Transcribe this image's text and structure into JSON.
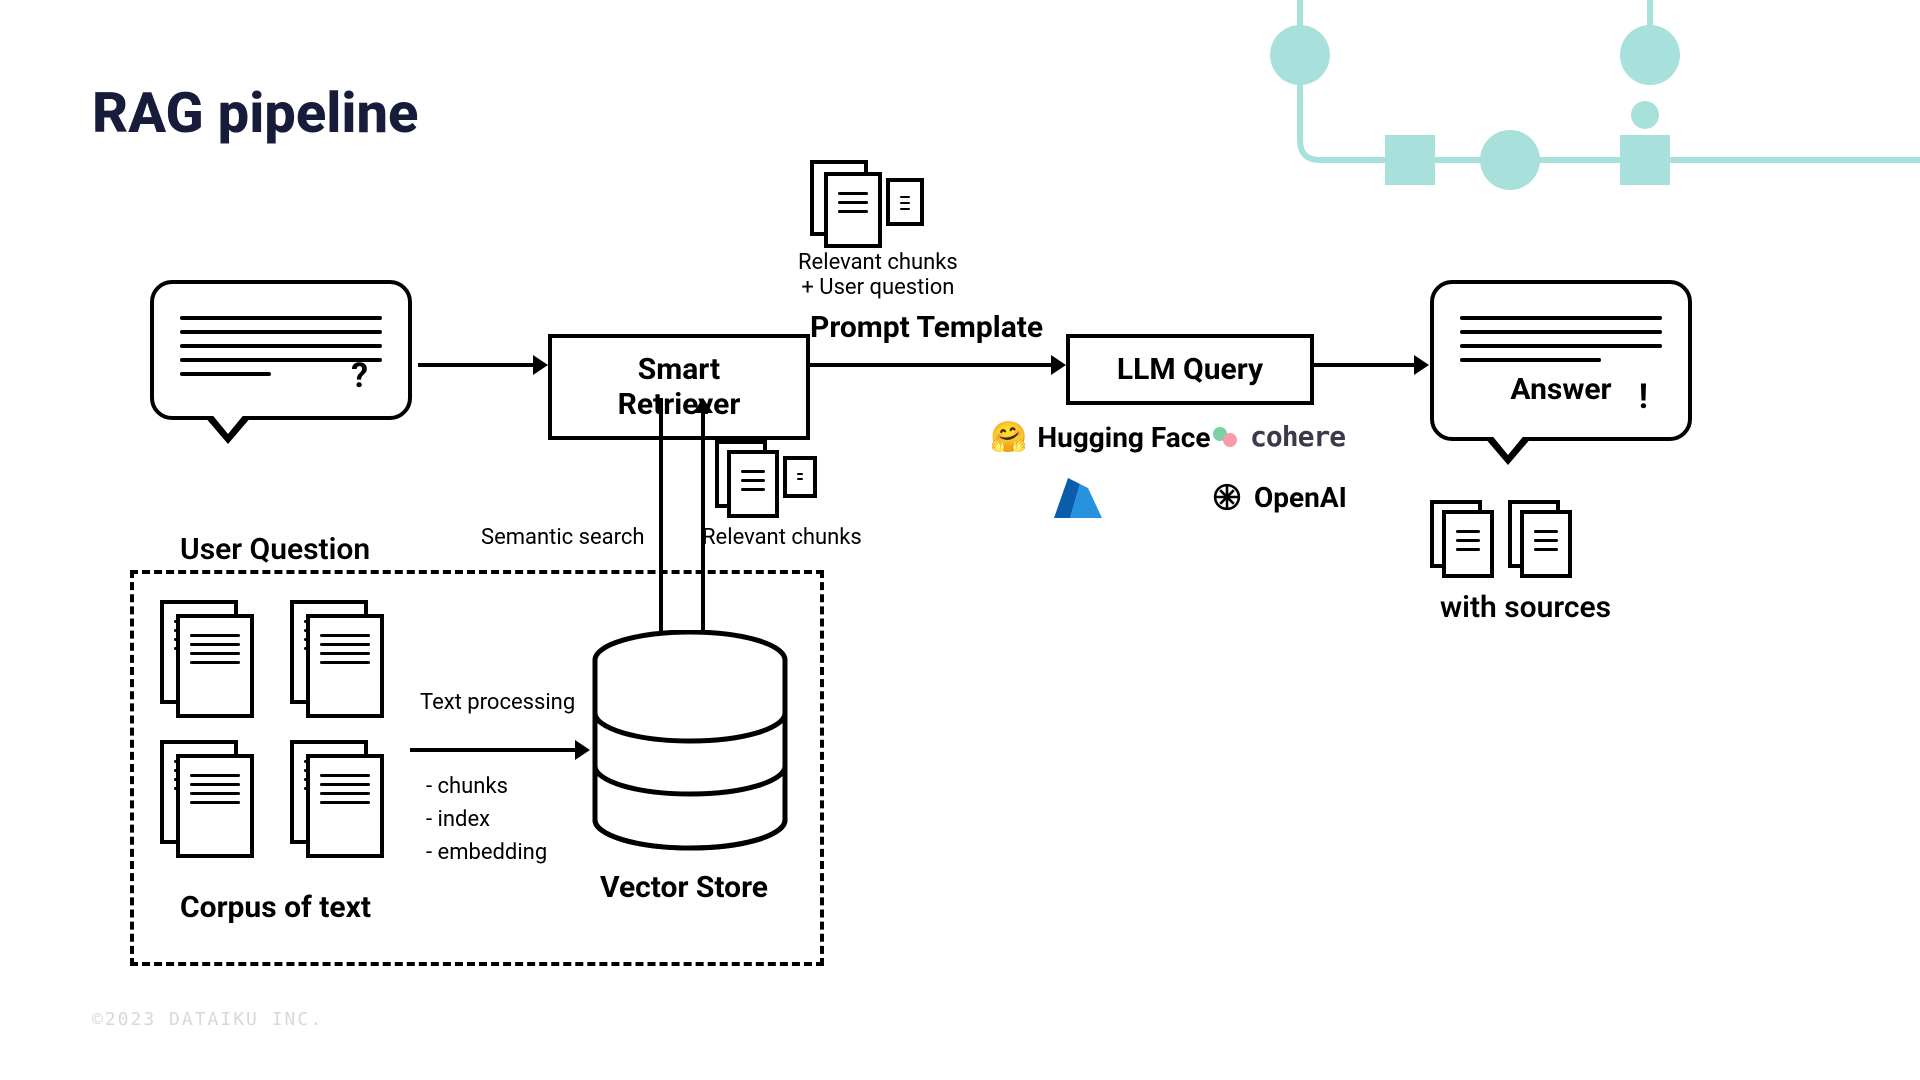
{
  "title": "RAG pipeline",
  "copyright": "©2023 DATAIKU INC.",
  "labels": {
    "user_question": "User Question",
    "smart_retriever": "Smart Retriever",
    "prompt_template": "Prompt Template",
    "relevant_chunks_user": "Relevant chunks\n+ User question",
    "llm_query": "LLM Query",
    "answer": "Answer",
    "with_sources": "with sources",
    "semantic_search": "Semantic search",
    "relevant_chunks": "Relevant chunks",
    "text_processing": "Text processing",
    "processing_items": "- chunks\n- index\n- embedding",
    "vector_store": "Vector Store",
    "corpus": "Corpus of text"
  },
  "llm_providers": {
    "huggingface": "Hugging Face",
    "cohere": "cohere",
    "azure": "Azure",
    "openai": "OpenAI"
  },
  "colors": {
    "teal": "#a8e0db",
    "dark": "#171c3a"
  }
}
